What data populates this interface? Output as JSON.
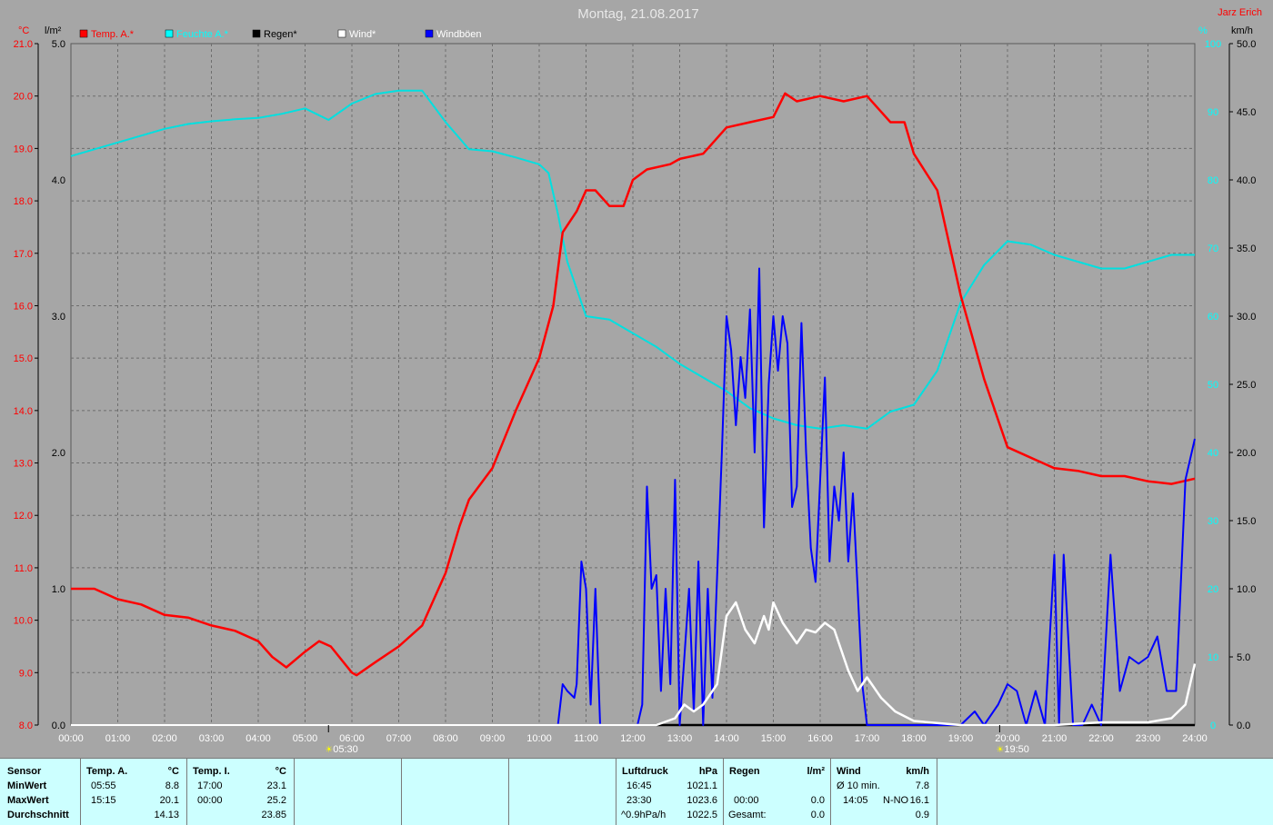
{
  "header": {
    "title": "Montag, 21.08.2017",
    "author": "Jarz Erich",
    "unit_left_temp": "°C",
    "unit_left_rain": "l/m²",
    "unit_right_humidity": "%",
    "unit_right_wind": "km/h"
  },
  "colors": {
    "background": "#a6a6a6",
    "temp": "#ff0000",
    "humidity": "#00e0e0",
    "rain": "#000000",
    "wind": "#ffffff",
    "gusts": "#0000ff",
    "panel": "#ccffff"
  },
  "legend": [
    {
      "label": "Temp. A.*",
      "color": "#ff0000",
      "text_color": "#ff0000"
    },
    {
      "label": "Feuchte A.*",
      "color": "#00ffff",
      "text_color": "#00ffff"
    },
    {
      "label": "Regen*",
      "color": "#000000",
      "text_color": "#000000"
    },
    {
      "label": "Wind*",
      "color": "#ffffff",
      "text_color": "#ffffff"
    },
    {
      "label": "Windböen",
      "color": "#0000ff",
      "text_color": "#ffffff"
    }
  ],
  "sun_markers": [
    {
      "label": "05:30",
      "hour": 5.5,
      "icon": "sunrise-icon"
    },
    {
      "label": "19:50",
      "hour": 19.833,
      "icon": "sunset-icon"
    }
  ],
  "chart_data": {
    "type": "line",
    "title": "Montag, 21.08.2017",
    "grid": true,
    "x_ticks": [
      "00:00",
      "01:00",
      "02:00",
      "03:00",
      "04:00",
      "05:00",
      "06:00",
      "07:00",
      "08:00",
      "09:00",
      "10:00",
      "11:00",
      "12:00",
      "13:00",
      "14:00",
      "15:00",
      "16:00",
      "17:00",
      "18:00",
      "19:00",
      "20:00",
      "21:00",
      "22:00",
      "23:00",
      "24:00"
    ],
    "xlim": [
      0,
      24
    ],
    "axes": {
      "temp": {
        "label": "°C",
        "range": [
          8.0,
          21.0
        ],
        "ticks": [
          "8.0",
          "9.0",
          "10.0",
          "11.0",
          "12.0",
          "13.0",
          "14.0",
          "15.0",
          "16.0",
          "17.0",
          "18.0",
          "19.0",
          "20.0",
          "21.0"
        ]
      },
      "rain": {
        "label": "l/m²",
        "range": [
          0.0,
          5.0
        ],
        "ticks": [
          "0.0",
          "1.0",
          "2.0",
          "3.0",
          "4.0",
          "5.0"
        ]
      },
      "humidity": {
        "label": "%",
        "range": [
          0,
          100
        ],
        "ticks": [
          "0",
          "10",
          "20",
          "30",
          "40",
          "50",
          "60",
          "70",
          "80",
          "90",
          "100"
        ]
      },
      "wind": {
        "label": "km/h",
        "range": [
          0.0,
          50.0
        ],
        "ticks": [
          "0.0",
          "5.0",
          "10.0",
          "15.0",
          "20.0",
          "25.0",
          "30.0",
          "35.0",
          "40.0",
          "45.0",
          "50.0"
        ]
      }
    },
    "series": [
      {
        "name": "Temp. A.*",
        "axis": "temp",
        "color": "#ff0000",
        "x": [
          0,
          0.5,
          1,
          1.5,
          2,
          2.5,
          3,
          3.5,
          4,
          4.3,
          4.6,
          5,
          5.3,
          5.55,
          6,
          6.1,
          6.5,
          7,
          7.5,
          8,
          8.3,
          8.5,
          9,
          9.5,
          10,
          10.3,
          10.5,
          10.8,
          11,
          11.2,
          11.5,
          11.8,
          12,
          12.3,
          12.8,
          13,
          13.5,
          14,
          14.5,
          15,
          15.25,
          15.5,
          16,
          16.5,
          17,
          17.5,
          17.8,
          18,
          18.5,
          19,
          19.5,
          20,
          20.5,
          21,
          21.5,
          22,
          22.5,
          23,
          23.5,
          24
        ],
        "y": [
          10.6,
          10.6,
          10.4,
          10.3,
          10.1,
          10.05,
          9.9,
          9.8,
          9.6,
          9.3,
          9.1,
          9.4,
          9.6,
          9.5,
          9.0,
          8.95,
          9.2,
          9.5,
          9.9,
          10.9,
          11.8,
          12.3,
          12.9,
          14.0,
          15.0,
          16.0,
          17.4,
          17.8,
          18.2,
          18.2,
          17.9,
          17.9,
          18.4,
          18.6,
          18.7,
          18.8,
          18.9,
          19.4,
          19.5,
          19.6,
          20.05,
          19.9,
          20.0,
          19.9,
          20.0,
          19.5,
          19.5,
          18.9,
          18.2,
          16.2,
          14.6,
          13.3,
          13.1,
          12.9,
          12.85,
          12.75,
          12.75,
          12.65,
          12.6,
          12.7
        ]
      },
      {
        "name": "Feuchte A.*",
        "axis": "humidity",
        "color": "#00e0e0",
        "x": [
          0,
          0.5,
          1,
          1.5,
          2,
          2.5,
          3,
          3.5,
          4,
          4.5,
          5,
          5.5,
          6,
          6.5,
          7,
          7.5,
          8,
          8.5,
          9,
          9.5,
          10,
          10.2,
          10.4,
          10.6,
          10.8,
          11,
          11.5,
          12,
          12.5,
          13,
          13.5,
          14,
          14.5,
          15,
          15.5,
          16,
          16.5,
          17,
          17.5,
          18,
          18.5,
          19,
          19.5,
          20,
          20.5,
          21,
          21.5,
          22,
          22.5,
          23,
          23.5,
          24
        ],
        "y": [
          83.5,
          84.5,
          85.5,
          86.5,
          87.5,
          88.2,
          88.6,
          88.9,
          89.1,
          89.7,
          90.5,
          88.8,
          91.2,
          92.6,
          93.1,
          93.1,
          88.5,
          84.5,
          84.2,
          83.3,
          82.3,
          81.0,
          75.0,
          68.0,
          64.0,
          60.0,
          59.5,
          57.5,
          55.5,
          53.0,
          51.0,
          49.0,
          46.5,
          45.0,
          44.0,
          43.5,
          44.0,
          43.5,
          46.0,
          47.0,
          52.0,
          62.0,
          67.5,
          71.0,
          70.5,
          69.0,
          68.0,
          67.0,
          67.0,
          68.0,
          69.0,
          69.0
        ]
      },
      {
        "name": "Regen*",
        "axis": "rain",
        "color": "#000000",
        "x": [
          0,
          24
        ],
        "y": [
          0.0,
          0.0
        ]
      },
      {
        "name": "Wind*",
        "axis": "wind",
        "color": "#ffffff",
        "x": [
          0,
          12.5,
          12.9,
          13.1,
          13.3,
          13.5,
          13.8,
          14.0,
          14.2,
          14.4,
          14.6,
          14.8,
          14.9,
          15.0,
          15.2,
          15.5,
          15.7,
          15.9,
          16.1,
          16.3,
          16.6,
          16.8,
          17.0,
          17.3,
          17.6,
          18.0,
          19.0,
          20.0,
          21.0,
          22.0,
          23.0,
          23.5,
          23.8,
          24.0
        ],
        "y": [
          0,
          0,
          0.5,
          1.5,
          1.0,
          1.5,
          3.0,
          8.0,
          9.0,
          7.0,
          6.0,
          8.0,
          7.0,
          9.0,
          7.5,
          6.0,
          7.0,
          6.8,
          7.5,
          7.0,
          4.0,
          2.5,
          3.5,
          2.0,
          1.0,
          0.3,
          0,
          0,
          0,
          0.2,
          0.2,
          0.5,
          1.5,
          4.5
        ]
      },
      {
        "name": "Windböen",
        "axis": "wind",
        "color": "#0000ff",
        "x": [
          0,
          10.4,
          10.5,
          10.6,
          10.75,
          10.8,
          10.9,
          11.0,
          11.1,
          11.2,
          11.3,
          11.4,
          11.5,
          11.6,
          11.8,
          12.0,
          12.1,
          12.2,
          12.3,
          12.4,
          12.5,
          12.6,
          12.7,
          12.8,
          12.9,
          13.0,
          13.2,
          13.3,
          13.4,
          13.5,
          13.6,
          13.7,
          13.8,
          13.9,
          14.0,
          14.1,
          14.2,
          14.3,
          14.4,
          14.5,
          14.6,
          14.7,
          14.8,
          14.9,
          15.0,
          15.1,
          15.2,
          15.3,
          15.4,
          15.5,
          15.6,
          15.7,
          15.8,
          15.9,
          16.0,
          16.1,
          16.2,
          16.3,
          16.4,
          16.5,
          16.6,
          16.7,
          16.8,
          16.9,
          17.0,
          17.1,
          17.2,
          17.3,
          17.4,
          17.5,
          17.6,
          17.7,
          17.8,
          18.0,
          18.5,
          19.0,
          19.3,
          19.5,
          19.8,
          20.0,
          20.2,
          20.4,
          20.6,
          20.8,
          21.0,
          21.1,
          21.2,
          21.4,
          21.6,
          21.8,
          22.0,
          22.2,
          22.4,
          22.6,
          22.8,
          23.0,
          23.2,
          23.4,
          23.6,
          23.8,
          24.0
        ],
        "y": [
          0,
          0,
          3.0,
          2.5,
          2.0,
          3.0,
          12.0,
          10.0,
          1.5,
          10.0,
          0,
          0,
          0,
          0,
          0,
          0,
          0,
          1.5,
          17.5,
          10.0,
          11.0,
          2.5,
          10.0,
          3.0,
          18.0,
          0,
          10.0,
          1.0,
          12.0,
          0,
          10.0,
          2.0,
          11.0,
          20.0,
          30.0,
          27.5,
          22.0,
          27.0,
          24.0,
          30.5,
          20.0,
          33.5,
          14.5,
          25.0,
          30.0,
          26.0,
          30.0,
          28.0,
          16.0,
          17.5,
          29.5,
          20.0,
          13.0,
          10.5,
          18.0,
          25.5,
          12.0,
          17.5,
          15.0,
          20.0,
          12.0,
          17.0,
          10.0,
          3.0,
          0,
          0,
          0,
          0,
          0,
          0,
          0,
          0,
          0,
          0,
          0,
          0,
          1.0,
          0,
          1.5,
          3.0,
          2.5,
          0,
          2.5,
          0,
          12.5,
          0,
          12.5,
          0,
          0,
          1.5,
          0,
          12.5,
          2.5,
          5.0,
          4.5,
          5.0,
          6.5,
          2.5,
          2.5,
          18.0,
          21.0
        ]
      }
    ]
  },
  "panel": {
    "sensor": {
      "header": "Sensor",
      "rows": [
        "MinWert",
        "MaxWert",
        "Durchschnitt"
      ]
    },
    "temp_a": {
      "header": "Temp. A.",
      "unit": "°C",
      "times": [
        "05:55",
        "15:15",
        ""
      ],
      "values": [
        "8.8",
        "20.1",
        "14.13"
      ]
    },
    "temp_i": {
      "header": "Temp. I.",
      "unit": "°C",
      "times": [
        "17:00",
        "00:00",
        ""
      ],
      "values": [
        "23.1",
        "25.2",
        "23.85"
      ]
    },
    "pressure": {
      "header": "Luftdruck",
      "unit": "hPa",
      "times": [
        "16:45",
        "23:30",
        "^0.9hPa/h"
      ],
      "values": [
        "1021.1",
        "1023.6",
        "1022.5"
      ]
    },
    "rain": {
      "header": "Regen",
      "unit": "l/m²",
      "times": [
        "",
        "00:00",
        "Gesamt:"
      ],
      "values": [
        "",
        "0.0",
        "0.0"
      ],
      "extra": "0.0"
    },
    "wind": {
      "header": "Wind",
      "unit": "km/h",
      "labels": [
        "Ø 10 min.",
        "14:05",
        ""
      ],
      "dirs": [
        "",
        "N-NO",
        ""
      ],
      "values": [
        "7.8",
        "16.1",
        "0.9"
      ]
    }
  }
}
